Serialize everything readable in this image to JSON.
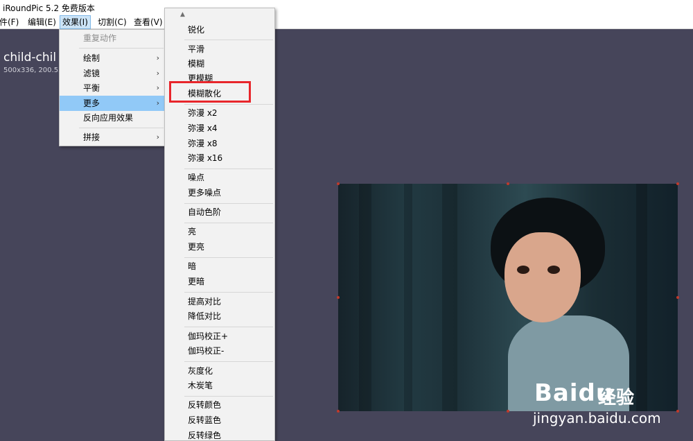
{
  "window": {
    "title": "iRoundPic 5.2 免费版本"
  },
  "menubar": [
    {
      "label": "件(F)",
      "active": false
    },
    {
      "label": "编辑(E)",
      "active": false
    },
    {
      "label": "效果(I)",
      "active": true
    },
    {
      "label": "切割(C)",
      "active": false
    },
    {
      "label": "查看(V)",
      "active": false
    }
  ],
  "document": {
    "name": "child-chil",
    "info": "500x336, 200.52"
  },
  "effects_menu": {
    "items": [
      {
        "label": "重复动作",
        "disabled": true
      },
      {
        "label": "绘制",
        "submenu": true
      },
      {
        "label": "滤镜",
        "submenu": true
      },
      {
        "label": "平衡",
        "submenu": true
      },
      {
        "label": "更多",
        "submenu": true,
        "highlighted": true
      },
      {
        "label": "反向应用效果"
      },
      {
        "label": "拼接",
        "submenu": true
      }
    ],
    "submenu_arrow": "›"
  },
  "more_menu": {
    "scroll_up_glyph": "▲",
    "groups": [
      [
        "锐化"
      ],
      [
        "平滑",
        "模糊",
        "更模糊",
        "模糊散化"
      ],
      [
        "弥漫 x2",
        "弥漫 x4",
        "弥漫 x8",
        "弥漫 x16"
      ],
      [
        "噪点",
        "更多噪点"
      ],
      [
        "自动色阶"
      ],
      [
        "亮",
        "更亮"
      ],
      [
        "暗",
        "更暗"
      ],
      [
        "提高对比",
        "降低对比"
      ],
      [
        "伽玛校正+",
        "伽玛校正-"
      ],
      [
        "灰度化",
        "木炭笔"
      ],
      [
        "反转颜色",
        "反转蓝色",
        "反转绿色"
      ]
    ],
    "outlined_item": "模糊散化",
    "outline_color": "#e8262b"
  },
  "watermark": {
    "logo": "Baidu",
    "product": "经验",
    "url": "jingyan.baidu.com"
  }
}
